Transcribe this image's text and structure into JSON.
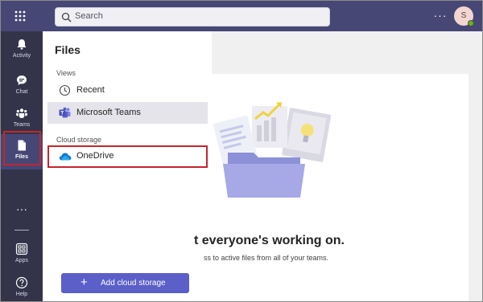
{
  "topbar": {
    "search_placeholder": "Search",
    "more_label": "···",
    "avatar_initial": "S"
  },
  "rail": {
    "items": [
      {
        "label": "Activity",
        "icon": "bell-icon"
      },
      {
        "label": "Chat",
        "icon": "chat-icon"
      },
      {
        "label": "Teams",
        "icon": "teams-icon"
      },
      {
        "label": "Files",
        "icon": "file-icon",
        "active": true
      },
      {
        "label": "Apps",
        "icon": "apps-icon"
      },
      {
        "label": "Help",
        "icon": "help-icon"
      }
    ],
    "more_label": "···"
  },
  "panel": {
    "title": "Files",
    "views_label": "Views",
    "views": [
      {
        "label": "Recent",
        "icon": "clock-icon"
      },
      {
        "label": "Microsoft Teams",
        "icon": "teams-logo-icon",
        "selected": true
      }
    ],
    "cloud_label": "Cloud storage",
    "cloud": [
      {
        "label": "OneDrive",
        "icon": "onedrive-icon"
      }
    ],
    "add_button": {
      "plus": "+",
      "label": "Add cloud storage"
    }
  },
  "main": {
    "headline": "t everyone's working on.",
    "subline": "ss to active files from all of your teams."
  },
  "colors": {
    "topbar": "#464775",
    "rail": "#33344a",
    "accent": "#5b5fc7",
    "highlight_box": "#c4262e"
  }
}
